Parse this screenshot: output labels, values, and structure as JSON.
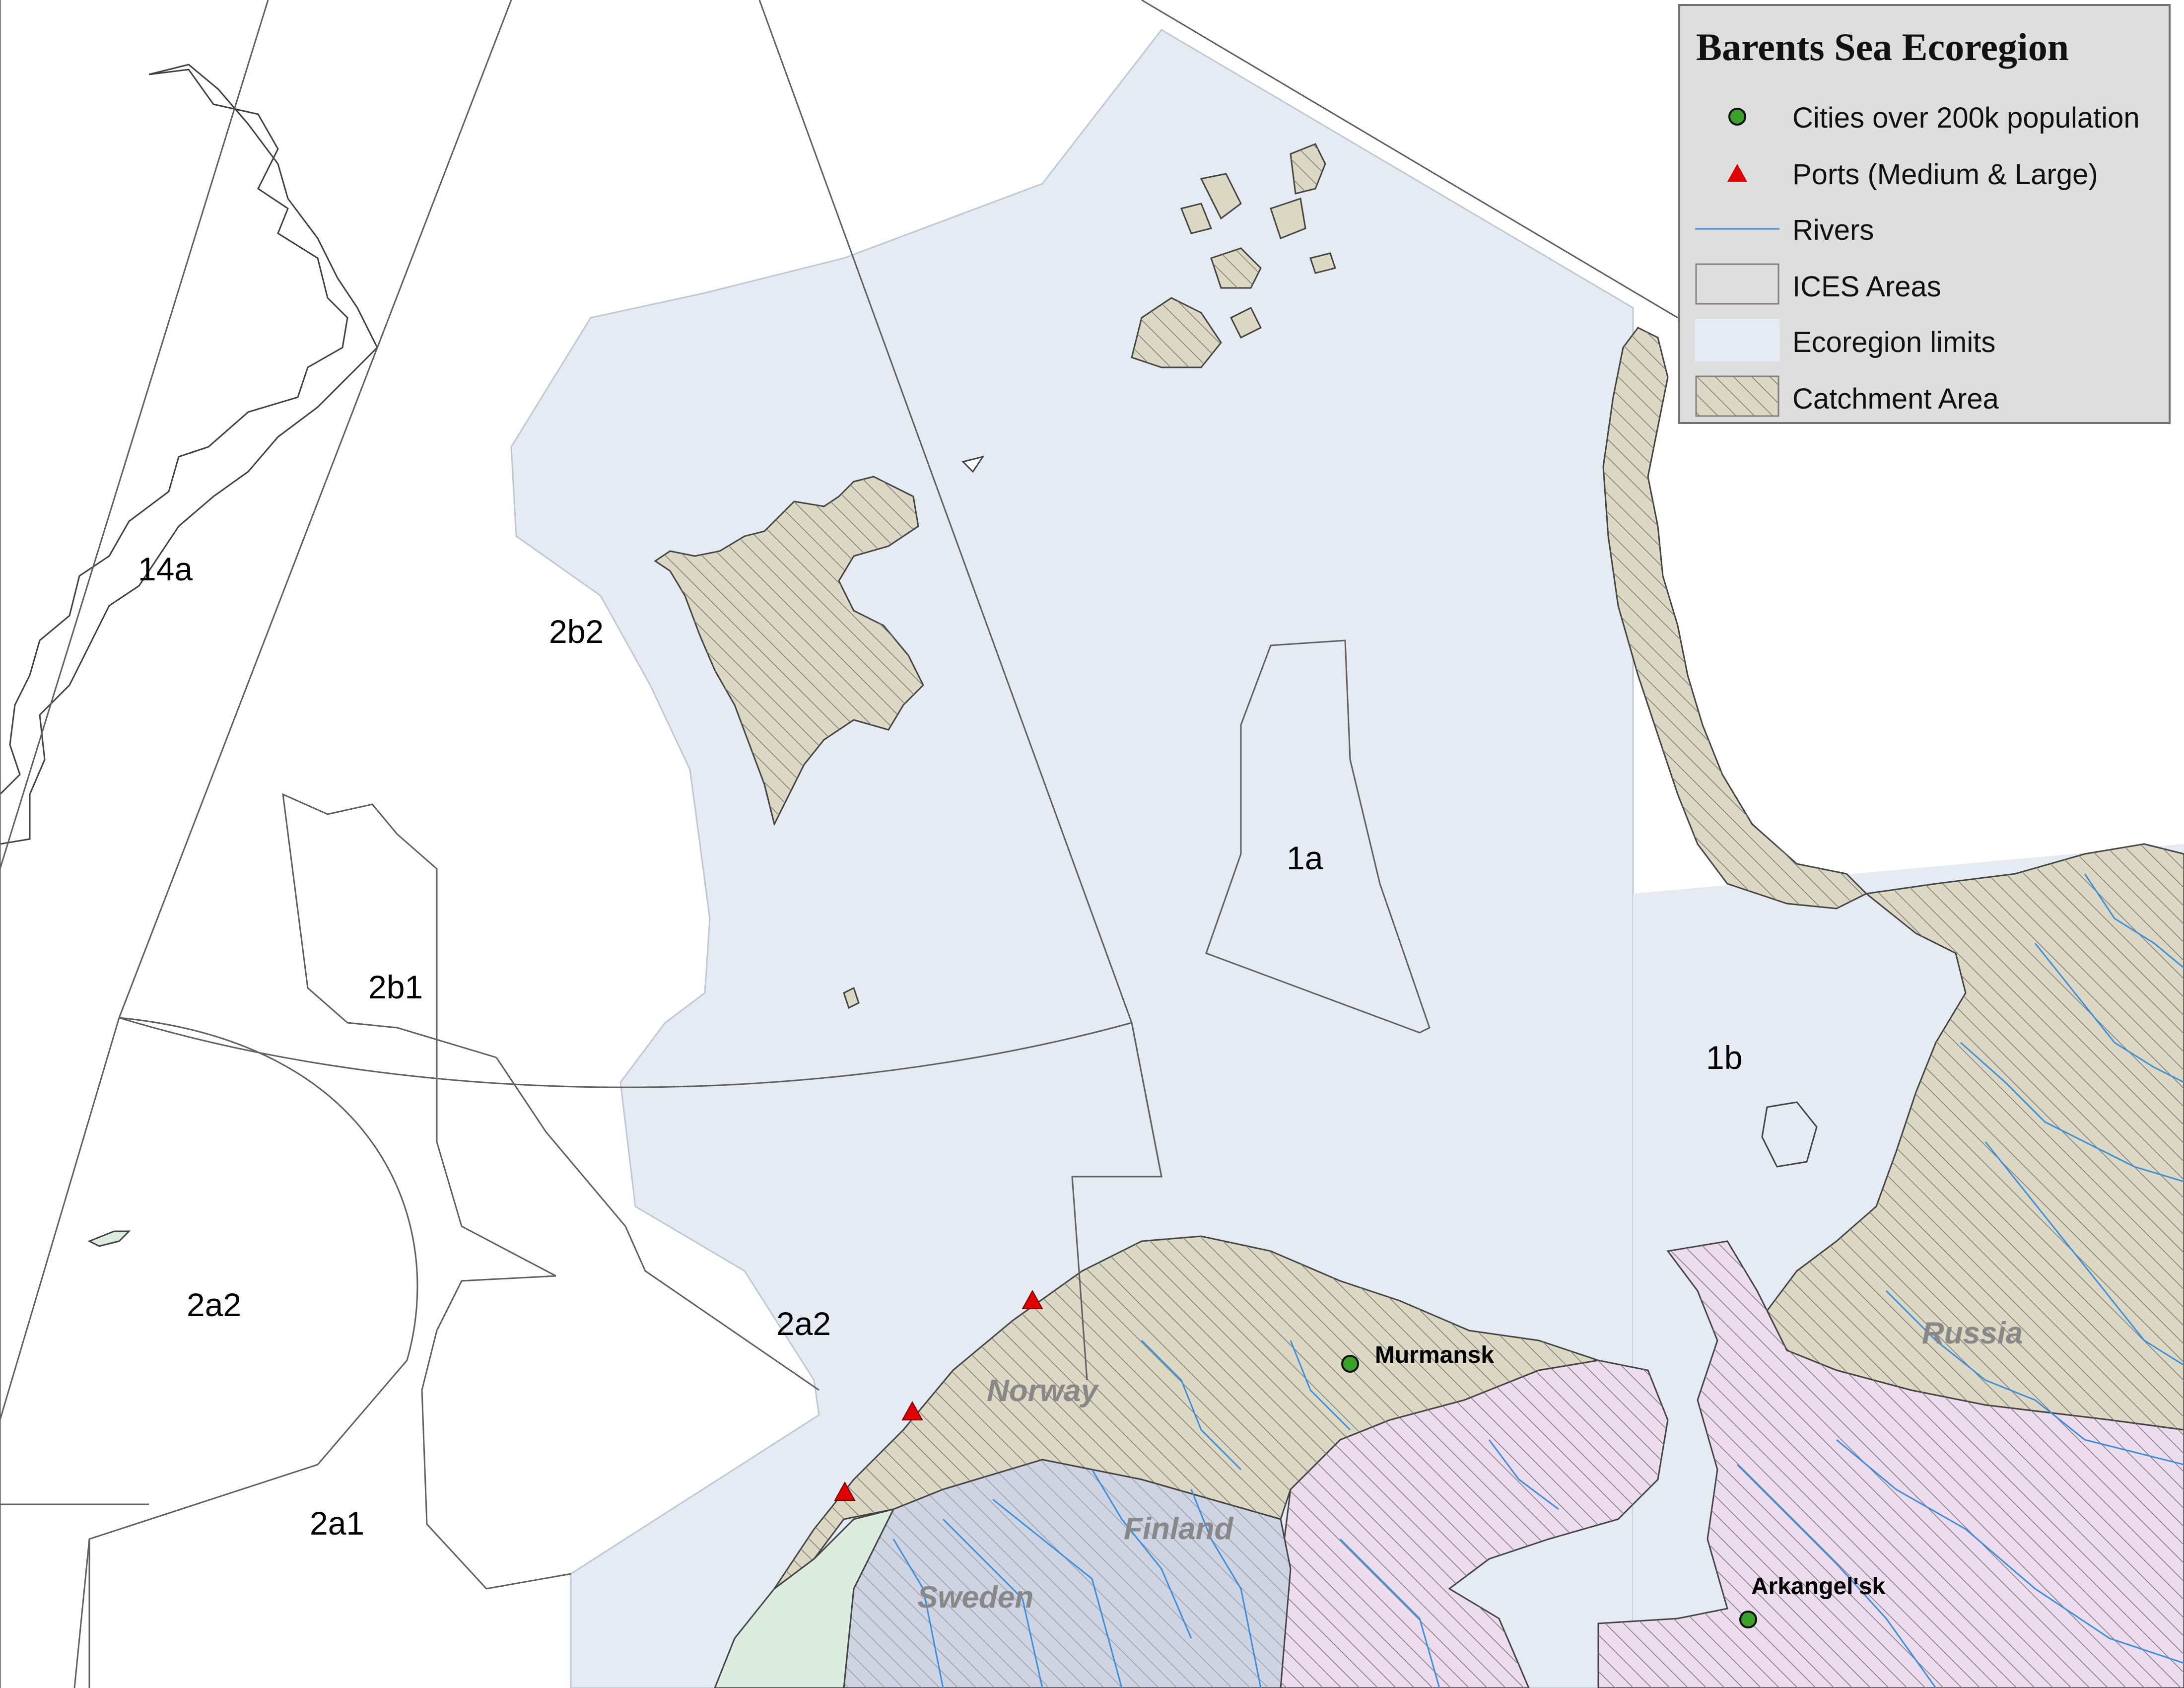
{
  "map": {
    "title": "Barents Sea Ecoregion",
    "colors": {
      "ecoregion_fill": "#e5ebf3",
      "land_fill": "#ddd8c4",
      "russia_pink": "#eddbee",
      "sweden_finland": "#cfd4e3",
      "norway_green": "#dcede0",
      "river": "#3b8fdb",
      "city": "#3aa12a",
      "port": "#e00000",
      "boundary": "#606060"
    },
    "area_labels": [
      "14a",
      "2b2",
      "2b1",
      "1a",
      "1b",
      "2a2",
      "2a2",
      "2a1"
    ],
    "country_labels": [
      "Norway",
      "Finland",
      "Sweden",
      "Russia"
    ],
    "cities": [
      "Murmansk",
      "Arkangel'sk"
    ]
  },
  "legend": {
    "title": "Barents Sea Ecoregion",
    "items": [
      {
        "label": "Cities over 200k population",
        "icon": "city-dot-icon"
      },
      {
        "label": "Ports (Medium & Large)",
        "icon": "port-triangle-icon"
      },
      {
        "label": "Rivers",
        "icon": "river-line-icon"
      },
      {
        "label": "ICES Areas",
        "icon": "ices-area-swatch"
      },
      {
        "label": "Ecoregion limits",
        "icon": "ecoregion-swatch"
      },
      {
        "label": "Catchment Area",
        "icon": "catchment-hatch-swatch"
      }
    ]
  }
}
